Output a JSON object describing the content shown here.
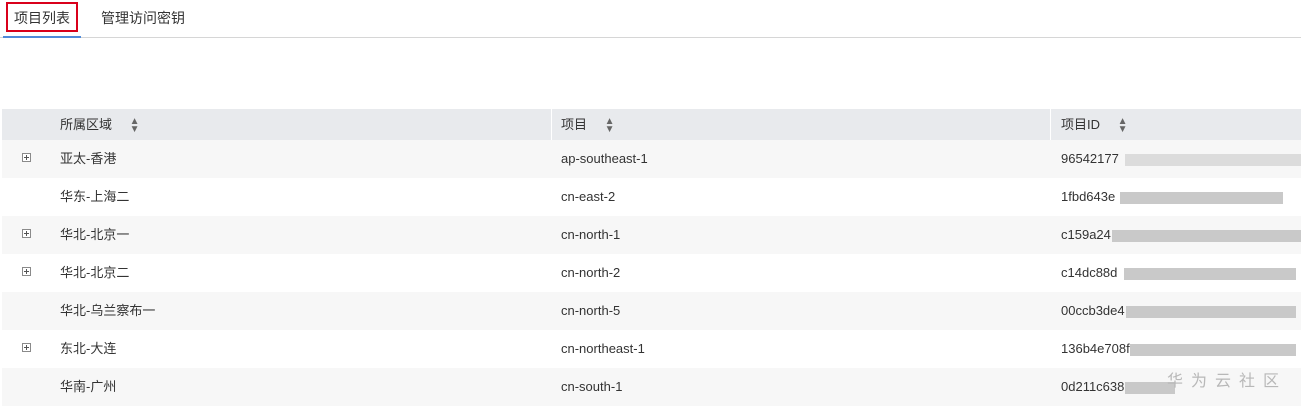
{
  "tabs": [
    {
      "label": "项目列表"
    },
    {
      "label": "管理访问密钥"
    }
  ],
  "table": {
    "columns": [
      {
        "label": "所属区域"
      },
      {
        "label": "项目"
      },
      {
        "label": "项目ID"
      }
    ],
    "rows": [
      {
        "region": "亚太-香港",
        "project": "ap-southeast-1",
        "project_id": "96542177",
        "expandable": true
      },
      {
        "region": "华东-上海二",
        "project": "cn-east-2",
        "project_id": "1fbd643e",
        "expandable": false
      },
      {
        "region": "华北-北京一",
        "project": "cn-north-1",
        "project_id": "c159a24",
        "expandable": true
      },
      {
        "region": "华北-北京二",
        "project": "cn-north-2",
        "project_id": "c14dc88d",
        "expandable": true
      },
      {
        "region": "华北-乌兰察布一",
        "project": "cn-north-5",
        "project_id": "00ccb3de4",
        "expandable": false
      },
      {
        "region": "东北-大连",
        "project": "cn-northeast-1",
        "project_id": "136b4e708f",
        "expandable": true
      },
      {
        "region": "华南-广州",
        "project": "cn-south-1",
        "project_id": "0d211c638",
        "expandable": false
      }
    ]
  },
  "watermark": "华为云社区",
  "icons": {
    "sort": "sort-icon",
    "expand": "expand-plus-icon"
  },
  "colors": {
    "tab_highlight": "#d9001b",
    "tab_underline": "#4f8ad9",
    "header_bg": "#e8eaed",
    "alt_row_bg": "#f7f7f7"
  }
}
